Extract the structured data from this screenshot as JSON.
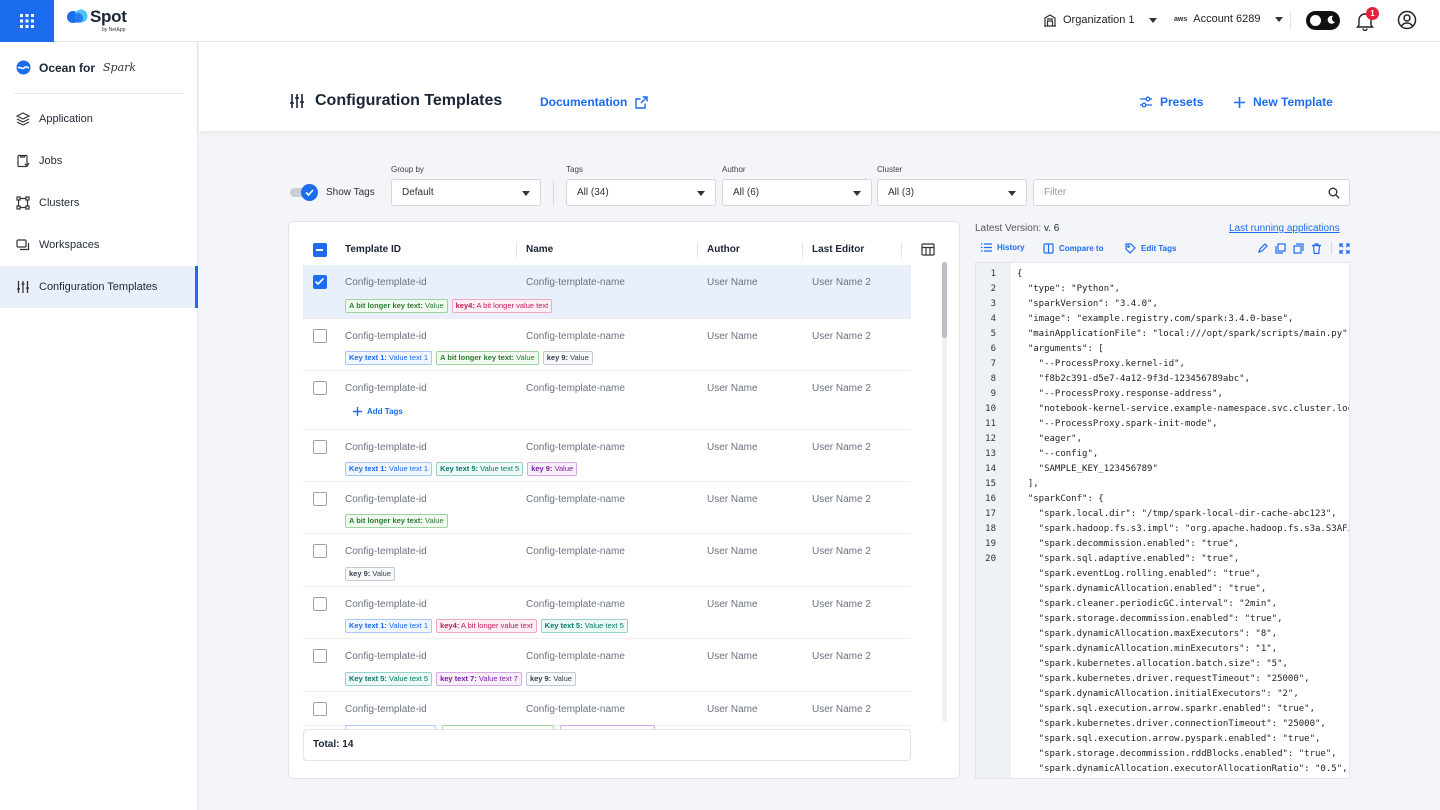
{
  "topbar": {
    "logo": "Spot",
    "logo_sub": "by NetApp",
    "org": "Organization 1",
    "account_prefix": "aws",
    "account": "Account 6289",
    "notifications": "1"
  },
  "sidebar": {
    "product": "Ocean for",
    "product_suffix": "Spark",
    "items": [
      {
        "label": "Application"
      },
      {
        "label": "Jobs"
      },
      {
        "label": "Clusters"
      },
      {
        "label": "Workspaces"
      },
      {
        "label": "Configuration Templates"
      }
    ]
  },
  "header": {
    "title": "Configuration Templates",
    "documentation": "Documentation",
    "presets": "Presets",
    "new_template": "New Template"
  },
  "filters": {
    "show_tags": "Show Tags",
    "group_by_label": "Group by",
    "group_by": "Default",
    "tags_label": "Tags",
    "tags": "All (34)",
    "author_label": "Author",
    "author": "All (6)",
    "cluster_label": "Cluster",
    "cluster": "All (3)",
    "search_placeholder": "Filter"
  },
  "table": {
    "columns": [
      "Template ID",
      "Name",
      "Author",
      "Last Editor"
    ],
    "add_tags": "Add Tags",
    "total": "Total: 14",
    "rows": [
      {
        "id": "Config-template-id",
        "name": "Config-template-name",
        "author": "User Name",
        "editor": "User Name 2",
        "selected": true,
        "tags": [
          {
            "k": "A bit longer key text:",
            "v": "Value",
            "c": "green"
          },
          {
            "k": "key4:",
            "v": "A bit longer value text",
            "c": "pink"
          }
        ]
      },
      {
        "id": "Config-template-id",
        "name": "Config-template-name",
        "author": "User Name",
        "editor": "User Name 2",
        "tags": [
          {
            "k": "Key text 1:",
            "v": "Value text 1",
            "c": "blue"
          },
          {
            "k": "A bit longer key text:",
            "v": "Value",
            "c": "green"
          },
          {
            "k": "key 9:",
            "v": "Value",
            "c": "gray"
          }
        ]
      },
      {
        "id": "Config-template-id",
        "name": "Config-template-name",
        "author": "User Name",
        "editor": "User Name 2",
        "tags": []
      },
      {
        "id": "Config-template-id",
        "name": "Config-template-name",
        "author": "User Name",
        "editor": "User Name 2",
        "tags": [
          {
            "k": "Key text 1:",
            "v": "Value text 1",
            "c": "blue"
          },
          {
            "k": "Key text 5:",
            "v": "Value text 5",
            "c": "teal"
          },
          {
            "k": "key 9:",
            "v": "Value",
            "c": "purple"
          }
        ]
      },
      {
        "id": "Config-template-id",
        "name": "Config-template-name",
        "author": "User Name",
        "editor": "User Name 2",
        "tags": [
          {
            "k": "A bit longer key text:",
            "v": "Value",
            "c": "green"
          }
        ]
      },
      {
        "id": "Config-template-id",
        "name": "Config-template-name",
        "author": "User Name",
        "editor": "User Name 2",
        "tags": [
          {
            "k": "key 9:",
            "v": "Value",
            "c": "gray"
          }
        ]
      },
      {
        "id": "Config-template-id",
        "name": "Config-template-name",
        "author": "User Name",
        "editor": "User Name 2",
        "tags": [
          {
            "k": "Key text 1:",
            "v": "Value text 1",
            "c": "blue"
          },
          {
            "k": "key4:",
            "v": "A bit longer value text",
            "c": "pink"
          },
          {
            "k": "Key text 5:",
            "v": "Value text 5",
            "c": "teal"
          }
        ]
      },
      {
        "id": "Config-template-id",
        "name": "Config-template-name",
        "author": "User Name",
        "editor": "User Name 2",
        "tags": [
          {
            "k": "Key text 5:",
            "v": "Value text 5",
            "c": "teal"
          },
          {
            "k": "key text 7:",
            "v": "Value text 7",
            "c": "purple"
          },
          {
            "k": "key 9:",
            "v": "Value",
            "c": "gray"
          }
        ]
      },
      {
        "id": "Config-template-id",
        "name": "Config-template-name",
        "author": "User Name",
        "editor": "User Name 2",
        "tags": []
      }
    ]
  },
  "details": {
    "latest_version_label": "Latest Version:",
    "latest_version": "v. 6",
    "last_running": "Last running applications",
    "history": "History",
    "compare": "Compare to",
    "edit_tags": "Edit Tags",
    "line_numbers": [
      "1",
      "2",
      "3",
      "4",
      "5",
      "6",
      "7",
      "8",
      "9",
      "10",
      "11",
      "12",
      "13",
      "14",
      "15",
      "16",
      "17",
      "18",
      "19",
      "20"
    ],
    "code": [
      "{",
      "  \"type\": \"Python\",",
      "  \"sparkVersion\": \"3.4.0\",",
      "  \"image\": \"example.registry.com/spark:3.4.0-base\",",
      "  \"mainApplicationFile\": \"local:///opt/spark/scripts/main.py\",",
      "  \"arguments\": [",
      "    \"--ProcessProxy.kernel-id\",",
      "    \"f8b2c391-d5e7-4a12-9f3d-123456789abc\",",
      "    \"--ProcessProxy.response-address\",",
      "    \"notebook-kernel-service.example-namespace.svc.cluster.loc",
      "    \"--ProcessProxy.spark-init-mode\",",
      "    \"eager\",",
      "    \"--config\",",
      "    \"SAMPLE_KEY_123456789\"",
      "  ],",
      "  \"sparkConf\": {",
      "    \"spark.local.dir\": \"/tmp/spark-local-dir-cache-abc123\",",
      "    \"spark.hadoop.fs.s3.impl\": \"org.apache.hadoop.fs.s3a.S3AFi",
      "    \"spark.decommission.enabled\": \"true\",",
      "    \"spark.sql.adaptive.enabled\": \"true\",",
      "    \"spark.eventLog.rolling.enabled\": \"true\",",
      "    \"spark.dynamicAllocation.enabled\": \"true\",",
      "    \"spark.cleaner.periodicGC.interval\": \"2min\",",
      "    \"spark.storage.decommission.enabled\": \"true\",",
      "    \"spark.dynamicAllocation.maxExecutors\": \"8\",",
      "    \"spark.dynamicAllocation.minExecutors\": \"1\",",
      "    \"spark.kubernetes.allocation.batch.size\": \"5\",",
      "    \"spark.kubernetes.driver.requestTimeout\": \"25000\",",
      "    \"spark.dynamicAllocation.initialExecutors\": \"2\",",
      "    \"spark.sql.execution.arrow.sparkr.enabled\": \"true\",",
      "    \"spark.kubernetes.driver.connectionTimeout\": \"25000\",",
      "    \"spark.sql.execution.arrow.pyspark.enabled\": \"true\",",
      "    \"spark.storage.decommission.rddBlocks.enabled\": \"true\",",
      "    \"spark.dynamicAllocation.executorAllocationRatio\": \"0.5\","
    ]
  }
}
